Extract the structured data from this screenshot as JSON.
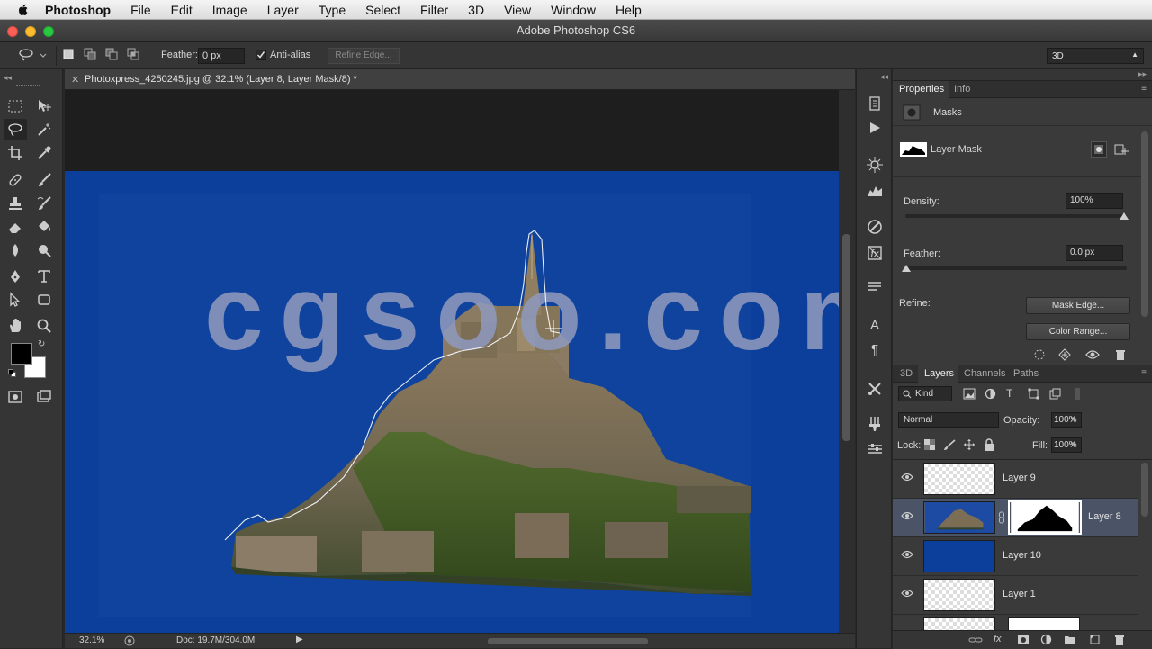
{
  "menubar": {
    "app": "Photoshop",
    "items": [
      "File",
      "Edit",
      "Image",
      "Layer",
      "Type",
      "Select",
      "Filter",
      "3D",
      "View",
      "Window",
      "Help"
    ]
  },
  "window": {
    "title": "Adobe Photoshop CS6"
  },
  "options": {
    "feather_label": "Feather:",
    "feather_value": "0 px",
    "antialias_label": "Anti-alias",
    "antialias_checked": true,
    "refine_edge": "Refine Edge...",
    "workspace": "3D"
  },
  "document": {
    "tab_title": "Photoxpress_4250245.jpg @ 32.1% (Layer 8, Layer Mask/8) *",
    "watermark": "cgsoo.com",
    "zoom": "32.1%",
    "doc_size": "Doc: 19.7M/304.0M"
  },
  "properties": {
    "tabs": [
      "Properties",
      "Info"
    ],
    "section": "Masks",
    "mask_label": "Layer Mask",
    "density_label": "Density:",
    "density_value": "100%",
    "feather_label": "Feather:",
    "feather_value": "0.0 px",
    "refine_label": "Refine:",
    "mask_edge": "Mask Edge...",
    "color_range": "Color Range..."
  },
  "layers_panel": {
    "tabs": [
      "3D",
      "Layers",
      "Channels",
      "Paths"
    ],
    "filter": "Kind",
    "blend_mode": "Normal",
    "opacity_label": "Opacity:",
    "opacity_value": "100%",
    "lock_label": "Lock:",
    "fill_label": "Fill:",
    "fill_value": "100%",
    "layers": [
      {
        "name": "Layer 9"
      },
      {
        "name": "Layer 8"
      },
      {
        "name": "Layer 10"
      },
      {
        "name": "Layer 1"
      }
    ]
  },
  "colors": {
    "canvas_blue": "#0b3f9b",
    "selected_row": "#4a5466"
  }
}
